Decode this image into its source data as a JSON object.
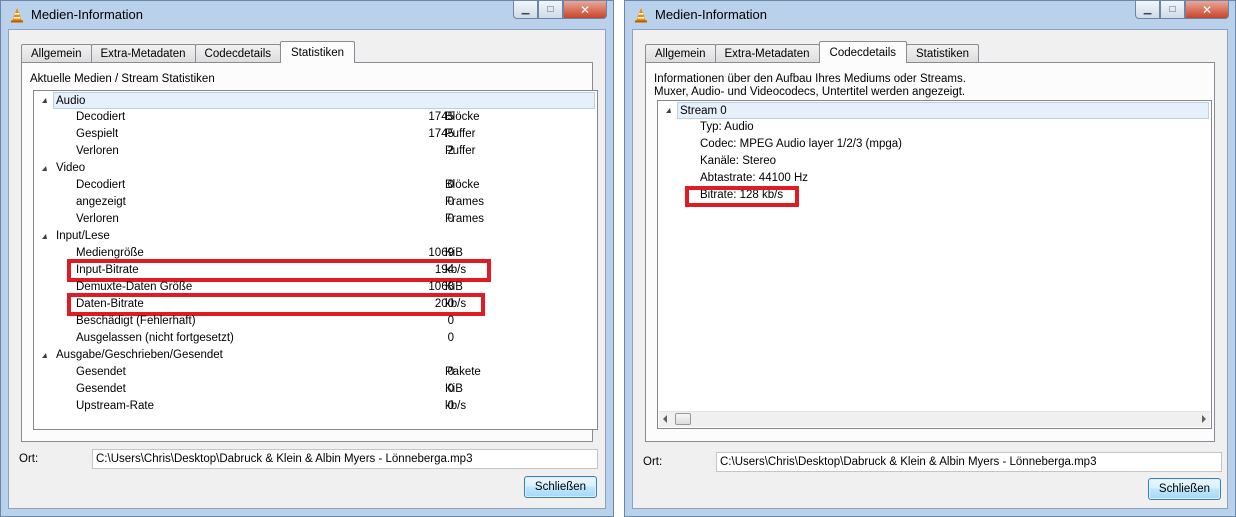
{
  "left_window": {
    "title": "Medien-Information",
    "tabs": [
      "Allgemein",
      "Extra-Metadaten",
      "Codecdetails",
      "Statistiken"
    ],
    "active_tab": "Statistiken",
    "section_title": "Aktuelle Medien / Stream Statistiken",
    "categories": [
      {
        "name": "Audio",
        "selected": true,
        "items": [
          {
            "label": "Decodiert",
            "value": "1745",
            "unit": "Blöcke"
          },
          {
            "label": "Gespielt",
            "value": "1745",
            "unit": "Puffer"
          },
          {
            "label": "Verloren",
            "value": "2",
            "unit": "Puffer"
          }
        ]
      },
      {
        "name": "Video",
        "selected": false,
        "items": [
          {
            "label": "Decodiert",
            "value": "0",
            "unit": "Blöcke"
          },
          {
            "label": "angezeigt",
            "value": "0",
            "unit": "Frames"
          },
          {
            "label": "Verloren",
            "value": "0",
            "unit": "Frames"
          }
        ]
      },
      {
        "name": "Input/Lese",
        "selected": false,
        "items": [
          {
            "label": "Mediengröße",
            "value": "1069",
            "unit": "KiB"
          },
          {
            "label": "Input-Bitrate",
            "value": "194",
            "unit": "kb/s"
          },
          {
            "label": "Demuxte-Daten Größe",
            "value": "1068",
            "unit": "KiB"
          },
          {
            "label": "Daten-Bitrate",
            "value": "200",
            "unit": "kb/s"
          },
          {
            "label": "Beschädigt (Fehlerhaft)",
            "value": "0",
            "unit": ""
          },
          {
            "label": "Ausgelassen (nicht fortgesetzt)",
            "value": "0",
            "unit": ""
          }
        ]
      },
      {
        "name": "Ausgabe/Geschrieben/Gesendet",
        "selected": false,
        "items": [
          {
            "label": "Gesendet",
            "value": "0",
            "unit": "Pakete"
          },
          {
            "label": "Gesendet",
            "value": "0",
            "unit": "KiB"
          },
          {
            "label": "Upstream-Rate",
            "value": "0",
            "unit": "kb/s"
          }
        ]
      }
    ],
    "location_label": "Ort:",
    "location_value": "C:\\Users\\Chris\\Desktop\\Dabruck & Klein & Albin Myers - Lönneberga.mp3",
    "close_button": "Schließen"
  },
  "right_window": {
    "title": "Medien-Information",
    "tabs": [
      "Allgemein",
      "Extra-Metadaten",
      "Codecdetails",
      "Statistiken"
    ],
    "active_tab": "Codecdetails",
    "description_line1": "Informationen über den Aufbau Ihres Mediums oder Streams.",
    "description_line2": "Muxer, Audio- und Videocodecs, Untertitel werden angezeigt.",
    "stream": {
      "name": "Stream 0",
      "fields": [
        "Typ: Audio",
        "Codec: MPEG Audio layer 1/2/3 (mpga)",
        "Kanäle: Stereo",
        "Abtastrate: 44100 Hz",
        "Bitrate: 128 kb/s"
      ]
    },
    "location_label": "Ort:",
    "location_value": "C:\\Users\\Chris\\Desktop\\Dabruck & Klein & Albin Myers - Lönneberga.mp3",
    "close_button": "Schließen"
  },
  "colors": {
    "highlight": "#e01b24",
    "window_frame": "#b9d1ea",
    "button_border": "#3c7fb1"
  },
  "icons": [
    "vlc-cone-icon",
    "minimize-icon",
    "maximize-icon",
    "close-icon",
    "expand-triangle-icon",
    "scroll-left-icon",
    "scroll-right-icon"
  ]
}
